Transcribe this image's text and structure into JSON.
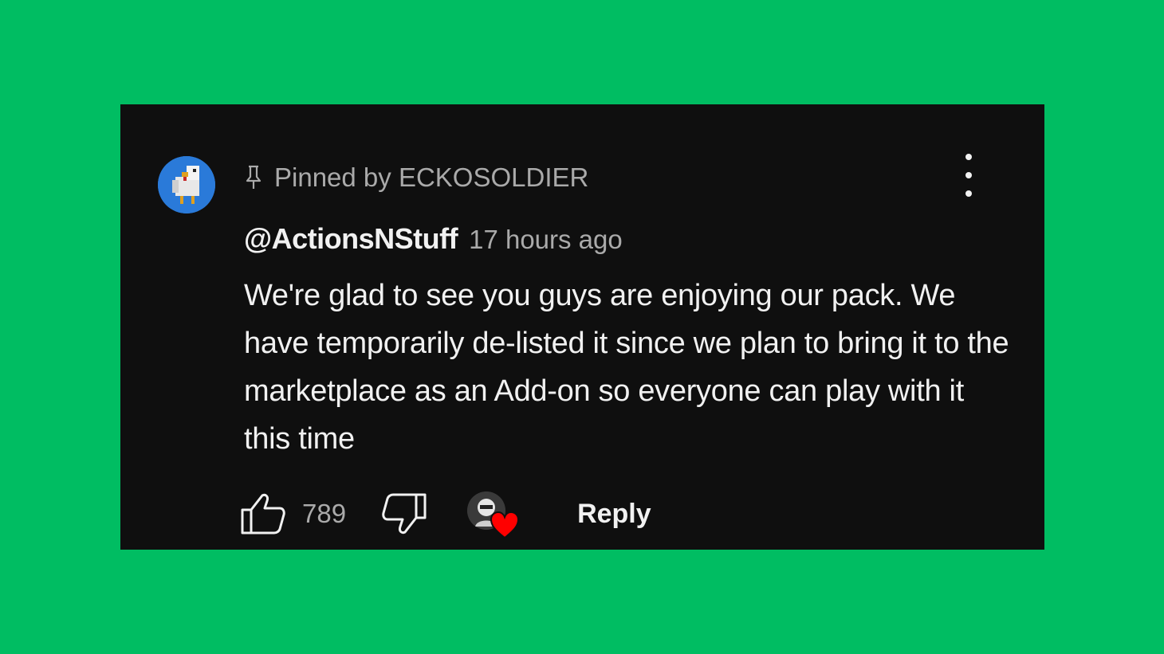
{
  "comment": {
    "pinned_label": "Pinned by ECKOSOLDIER",
    "author": "@ActionsNStuff",
    "timestamp": "17 hours ago",
    "text": "We're glad to see you guys are enjoying our pack. We have temporarily de-listed it since we plan to bring it to the marketplace as an Add-on so everyone can play with it this time",
    "like_count": "789",
    "reply_label": "Reply"
  },
  "colors": {
    "background": "#00bd62",
    "card": "#0f0f0f",
    "heart": "#ff0000"
  },
  "icons": {
    "avatar": "minecraft-chicken-avatar",
    "pin": "pin-icon",
    "menu": "more-vert-icon",
    "like": "thumb-up-icon",
    "dislike": "thumb-down-icon",
    "creator_heart": "creator-heart-icon"
  }
}
